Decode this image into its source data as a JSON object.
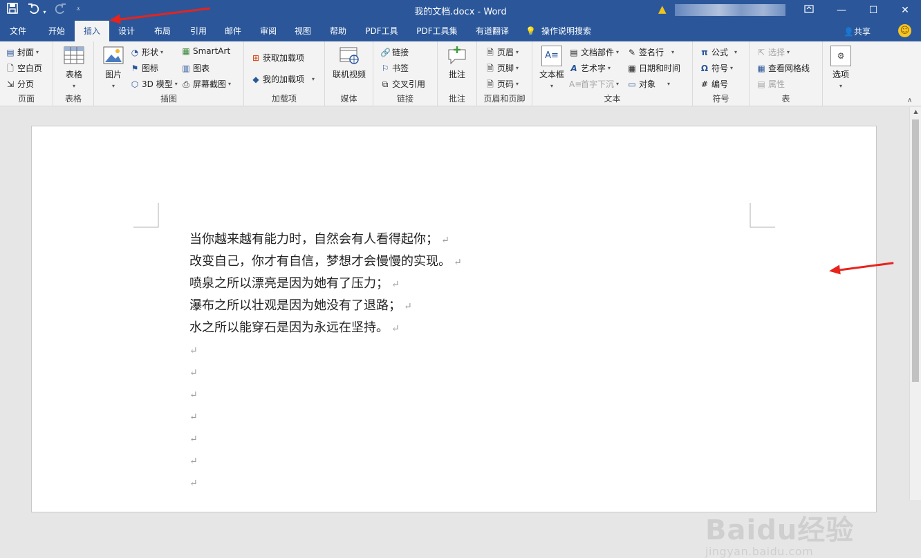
{
  "window": {
    "title": "我的文档.docx  -  Word",
    "qat": {
      "save_icon": "save-icon",
      "undo_icon": "undo-icon",
      "redo_icon": "redo-icon"
    }
  },
  "tabs": [
    "文件",
    "开始",
    "插入",
    "设计",
    "布局",
    "引用",
    "邮件",
    "审阅",
    "视图",
    "帮助",
    "PDF工具",
    "PDF工具集",
    "有道翻译"
  ],
  "active_tab": "插入",
  "tell_me": "操作说明搜索",
  "share": "共享",
  "ribbon": {
    "page": {
      "label": "页面",
      "cover": "封面",
      "blank": "空白页",
      "break": "分页"
    },
    "table": {
      "label": "表格",
      "btn": "表格"
    },
    "illus": {
      "label": "插图",
      "picture": "图片",
      "shapes": "形状",
      "icons": "图标",
      "model3d": "3D 模型",
      "smartart": "SmartArt",
      "chart": "图表",
      "screenshot": "屏幕截图"
    },
    "addins": {
      "label": "加载项",
      "get": "获取加载项",
      "my": "我的加载项"
    },
    "media": {
      "label": "媒体",
      "video": "联机视频"
    },
    "links": {
      "label": "链接",
      "link": "链接",
      "bookmark": "书签",
      "xref": "交叉引用"
    },
    "comments": {
      "label": "批注",
      "comment": "批注"
    },
    "hf": {
      "label": "页眉和页脚",
      "header": "页眉",
      "footer": "页脚",
      "pagenum": "页码"
    },
    "text": {
      "label": "文本",
      "textbox": "文本框",
      "parts": "文档部件",
      "wordart": "艺术字",
      "dropcap": "首字下沉",
      "sigline": "签名行",
      "datetime": "日期和时间",
      "object": "对象"
    },
    "symbols": {
      "label": "符号",
      "equation": "公式",
      "symbol": "符号",
      "number": "编号"
    },
    "table2": {
      "label": "表",
      "select": "选择",
      "gridlines": "查看网格线",
      "props": "属性"
    },
    "options": {
      "btn": "选项"
    }
  },
  "document": {
    "lines": [
      "当你越来越有能力时，自然会有人看得起你；",
      "改变自己，你才有自信，梦想才会慢慢的实现。",
      "喷泉之所以漂亮是因为她有了压力；",
      "瀑布之所以壮观是因为她没有了退路；",
      "水之所以能穿石是因为永远在坚持。"
    ],
    "empty_paragraphs": 7,
    "return_mark": "↵"
  },
  "watermark": {
    "brand": "Baidu经验",
    "url": "jingyan.baidu.com"
  },
  "colors": {
    "accent": "#2b579a",
    "arrow": "#e8231c"
  }
}
